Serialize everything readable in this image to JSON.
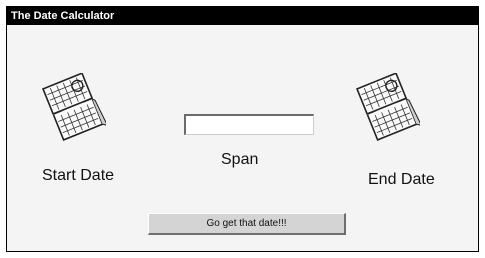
{
  "window": {
    "title": "The Date Calculator"
  },
  "start": {
    "label": "Start Date",
    "icon": "calendar-icon"
  },
  "end": {
    "label": "End Date",
    "icon": "calendar-icon"
  },
  "span": {
    "label": "Span",
    "value": ""
  },
  "actions": {
    "go_label": "Go get that date!!!"
  },
  "colors": {
    "titlebar": "#000000",
    "title_text": "#ffffff",
    "background": "#f4f4f4",
    "button": "#d4d4d4"
  }
}
